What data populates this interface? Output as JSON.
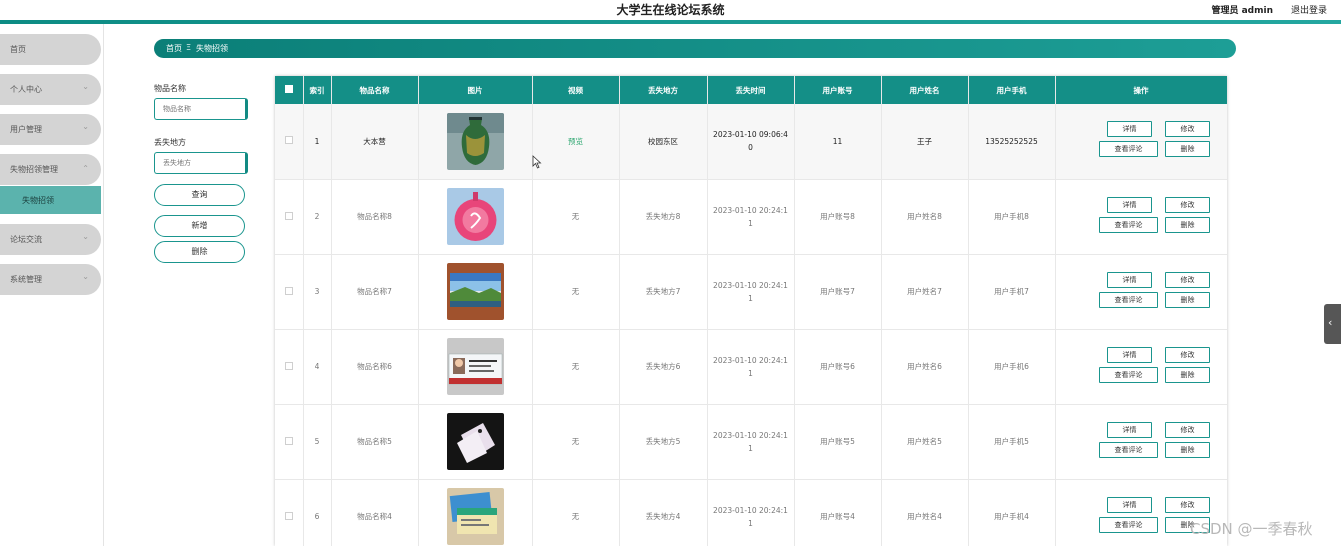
{
  "header": {
    "title": "大学生在线论坛系统",
    "admin": "管理员 admin",
    "logout": "退出登录"
  },
  "sidebar": {
    "items": [
      {
        "label": "首页",
        "chevron": false
      },
      {
        "label": "个人中心",
        "chevron": true
      },
      {
        "label": "用户管理",
        "chevron": true
      },
      {
        "label": "失物招领管理",
        "chevron": true,
        "expanded": true
      },
      {
        "label": "论坛交流",
        "chevron": true
      },
      {
        "label": "系统管理",
        "chevron": true
      }
    ],
    "sub_item": "失物招领"
  },
  "breadcrumb": {
    "home": "首页",
    "sep": "Ξ",
    "current": "失物招领"
  },
  "search": {
    "name_label": "物品名称",
    "name_placeholder": "物品名称",
    "place_label": "丢失地方",
    "place_placeholder": "丢失地方",
    "query_btn": "查询",
    "add_btn": "新增",
    "delete_btn": "删除"
  },
  "table": {
    "headers": [
      "",
      "索引",
      "物品名称",
      "图片",
      "视频",
      "丢失地方",
      "丢失时间",
      "用户账号",
      "用户姓名",
      "用户手机",
      "操作"
    ],
    "ops": {
      "detail": "详情",
      "edit": "修改",
      "comment": "查看评论",
      "delete": "删除"
    },
    "rows": [
      {
        "index": "1",
        "name": "大本营",
        "video": "预览",
        "place": "校园东区",
        "time": "2023-01-10 09:06:40",
        "account": "11",
        "username": "王子",
        "phone": "13525252525",
        "image": "vase"
      },
      {
        "index": "2",
        "name": "物品名称8",
        "video": "无",
        "place": "丢失地方8",
        "time": "2023-01-10 20:24:11",
        "account": "用户账号8",
        "username": "用户姓名8",
        "phone": "用户手机8",
        "image": "pink-tag"
      },
      {
        "index": "3",
        "name": "物品名称7",
        "video": "无",
        "place": "丢失地方7",
        "time": "2023-01-10 20:24:11",
        "account": "用户账号7",
        "username": "用户姓名7",
        "phone": "用户手机7",
        "image": "landscape-card"
      },
      {
        "index": "4",
        "name": "物品名称6",
        "video": "无",
        "place": "丢失地方6",
        "time": "2023-01-10 20:24:11",
        "account": "用户账号6",
        "username": "用户姓名6",
        "phone": "用户手机6",
        "image": "id-card"
      },
      {
        "index": "5",
        "name": "物品名称5",
        "video": "无",
        "place": "丢失地方5",
        "time": "2023-01-10 20:24:11",
        "account": "用户账号5",
        "username": "用户姓名5",
        "phone": "用户手机5",
        "image": "tag-dark"
      },
      {
        "index": "6",
        "name": "物品名称4",
        "video": "无",
        "place": "丢失地方4",
        "time": "2023-01-10 20:24:11",
        "account": "用户账号4",
        "username": "用户姓名4",
        "phone": "用户手机4",
        "image": "cards"
      }
    ]
  },
  "watermark": "CSDN @一季春秋",
  "colors": {
    "accent": "#148f87",
    "sidebar_item": "#d4d4d4",
    "sidebar_sub": "#5bb3ad"
  }
}
